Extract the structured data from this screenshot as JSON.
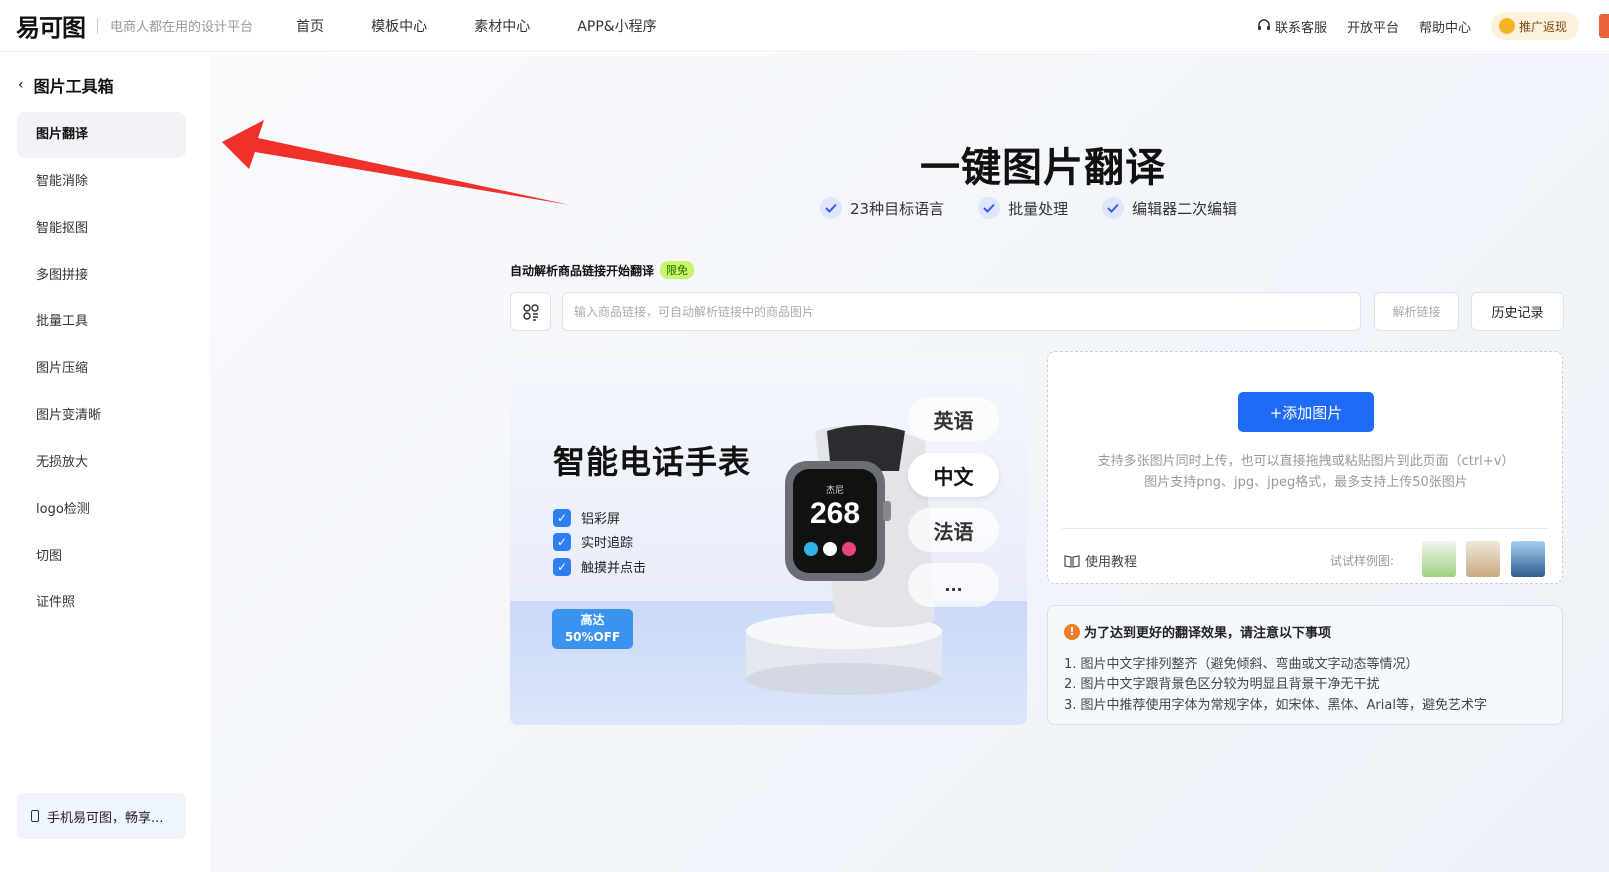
{
  "header": {
    "logo": "易可图",
    "slogan": "电商人都在用的设计平台",
    "nav": [
      "首页",
      "模板中心",
      "素材中心",
      "APP&小程序"
    ],
    "right": {
      "service": "联系客服",
      "open_platform": "开放平台",
      "help": "帮助中心",
      "promo": "推广返现"
    }
  },
  "sidebar": {
    "title": "图片工具箱",
    "items": [
      {
        "label": "图片翻译",
        "active": true
      },
      {
        "label": "智能消除"
      },
      {
        "label": "智能抠图"
      },
      {
        "label": "多图拼接"
      },
      {
        "label": "批量工具"
      },
      {
        "label": "图片压缩"
      },
      {
        "label": "图片变清晰"
      },
      {
        "label": "无损放大"
      },
      {
        "label": "logo检测"
      },
      {
        "label": "切图"
      },
      {
        "label": "证件照"
      }
    ],
    "mobile_banner": "手机易可图，畅享..."
  },
  "main": {
    "title": "一键图片翻译",
    "features": [
      "23种目标语言",
      "批量处理",
      "编辑器二次编辑"
    ],
    "auto_label": "自动解析商品链接开始翻译",
    "auto_badge": "限免",
    "url_placeholder": "输入商品链接，可自动解析链接中的商品图片",
    "parse_button": "解析链接",
    "history_button": "历史记录"
  },
  "sample": {
    "title": "智能电话手表",
    "features": [
      "铝彩屏",
      "实时追踪",
      "触摸并点击"
    ],
    "badge_line1": "高达",
    "badge_line2": "50%OFF",
    "watch_number": "268",
    "watch_brand": "杰尼",
    "languages": [
      "英语",
      "中文",
      "法语",
      "..."
    ],
    "selected_language": "中文"
  },
  "upload": {
    "add_button": "+添加图片",
    "tip_line1": "支持多张图片同时上传，也可以直接拖拽或粘贴图片到此页面（ctrl+v）",
    "tip_line2": "图片支持png、jpg、jpeg格式，最多支持上传50张图片",
    "tutorial": "使用教程",
    "try_label": "试试样例图:"
  },
  "notes": {
    "title": "为了达到更好的翻译效果，请注意以下事项",
    "items": [
      "1. 图片中文字排列整齐（避免倾斜、弯曲或文字动态等情况）",
      "2. 图片中文字跟背景色区分较为明显且背景干净无干扰",
      "3. 图片中推荐使用字体为常规字体，如宋体、黑体、Arial等，避免艺术字"
    ]
  },
  "colors": {
    "primary": "#1f6bf5",
    "arrow": "#f0302a",
    "badge_green": "#c8f56a"
  }
}
